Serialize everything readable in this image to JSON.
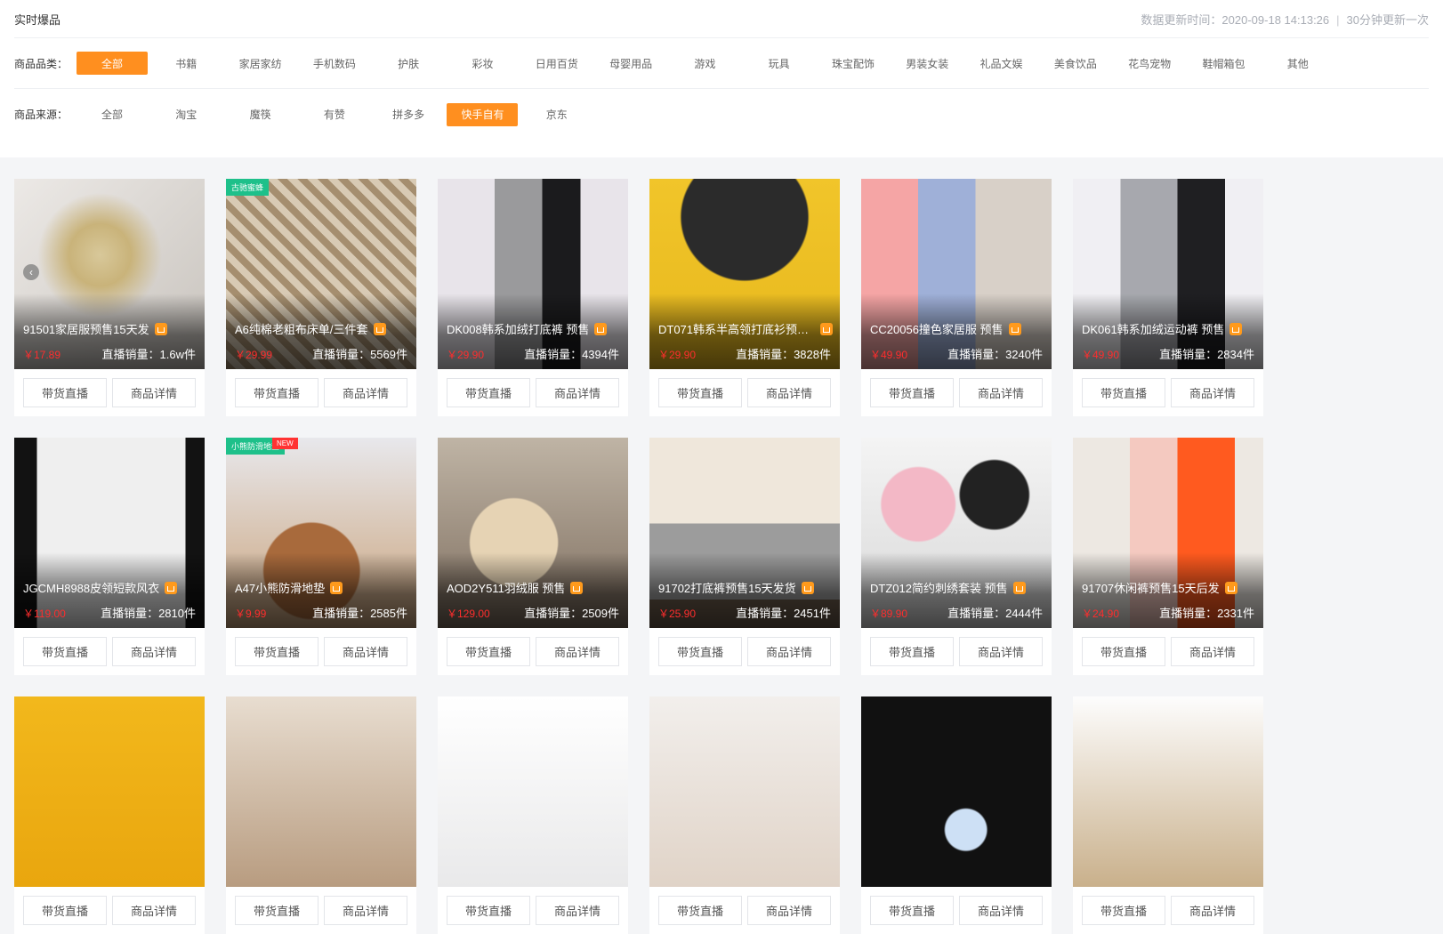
{
  "header": {
    "title": "实时爆品",
    "update_time": "数据更新时间：2020-09-18 14:13:26",
    "separator": "|",
    "update_freq": "30分钟更新一次"
  },
  "filters": {
    "category_label": "商品品类：",
    "categories": [
      "全部",
      "书籍",
      "家居家纺",
      "手机数码",
      "护肤",
      "彩妆",
      "日用百货",
      "母婴用品",
      "游戏",
      "玩具",
      "珠宝配饰",
      "男装女装",
      "礼品文娱",
      "美食饮品",
      "花鸟宠物",
      "鞋帽箱包",
      "其他"
    ],
    "category_active": 0,
    "source_label": "商品来源：",
    "sources": [
      "全部",
      "淘宝",
      "魔筷",
      "有赞",
      "拼多多",
      "快手自有",
      "京东"
    ],
    "source_active": 5
  },
  "card_buttons": {
    "live": "带货直播",
    "detail": "商品详情"
  },
  "products": [
    {
      "name": "91501家居服预售15天发",
      "price": "￥17.89",
      "sales": "直播销量：1.6w件"
    },
    {
      "name": "A6纯棉老粗布床单/三件套",
      "price": "￥29.99",
      "sales": "直播销量：5569件",
      "badge": "古驰蜜蜂"
    },
    {
      "name": "DK008韩系加绒打底裤 预售",
      "price": "￥29.90",
      "sales": "直播销量：4394件"
    },
    {
      "name": "DT071韩系半高领打底衫预售...",
      "price": "￥29.90",
      "sales": "直播销量：3828件"
    },
    {
      "name": "CC20056撞色家居服 预售",
      "price": "￥49.90",
      "sales": "直播销量：3240件"
    },
    {
      "name": "DK061韩系加绒运动裤 预售",
      "price": "￥49.90",
      "sales": "直播销量：2834件"
    },
    {
      "name": "JGCMH8988皮领短款风衣",
      "price": "￥119.00",
      "sales": "直播销量：2810件"
    },
    {
      "name": "A47小熊防滑地垫",
      "price": "￥9.99",
      "sales": "直播销量：2585件",
      "badge": "小熊防滑地垫",
      "badge_new": "NEW"
    },
    {
      "name": "AOD2Y511羽绒服 预售",
      "price": "￥129.00",
      "sales": "直播销量：2509件"
    },
    {
      "name": "91702打底裤预售15天发货",
      "price": "￥25.90",
      "sales": "直播销量：2451件"
    },
    {
      "name": "DTZ012简约刺绣套装 预售",
      "price": "￥89.90",
      "sales": "直播销量：2444件"
    },
    {
      "name": "91707休闲裤预售15天后发",
      "price": "￥24.90",
      "sales": "直播销量：2331件"
    },
    {
      "name": "",
      "price": "",
      "sales": ""
    },
    {
      "name": "",
      "price": "",
      "sales": ""
    },
    {
      "name": "",
      "price": "",
      "sales": ""
    },
    {
      "name": "",
      "price": "",
      "sales": ""
    },
    {
      "name": "",
      "price": "",
      "sales": ""
    },
    {
      "name": "",
      "price": "",
      "sales": ""
    }
  ],
  "colors": {
    "accent": "#ff8f1f",
    "price": "#ff2d2d",
    "badge_green": "#1ec08a"
  },
  "icons": {
    "shop": "shop-icon",
    "prev": "chevron-left-icon"
  }
}
